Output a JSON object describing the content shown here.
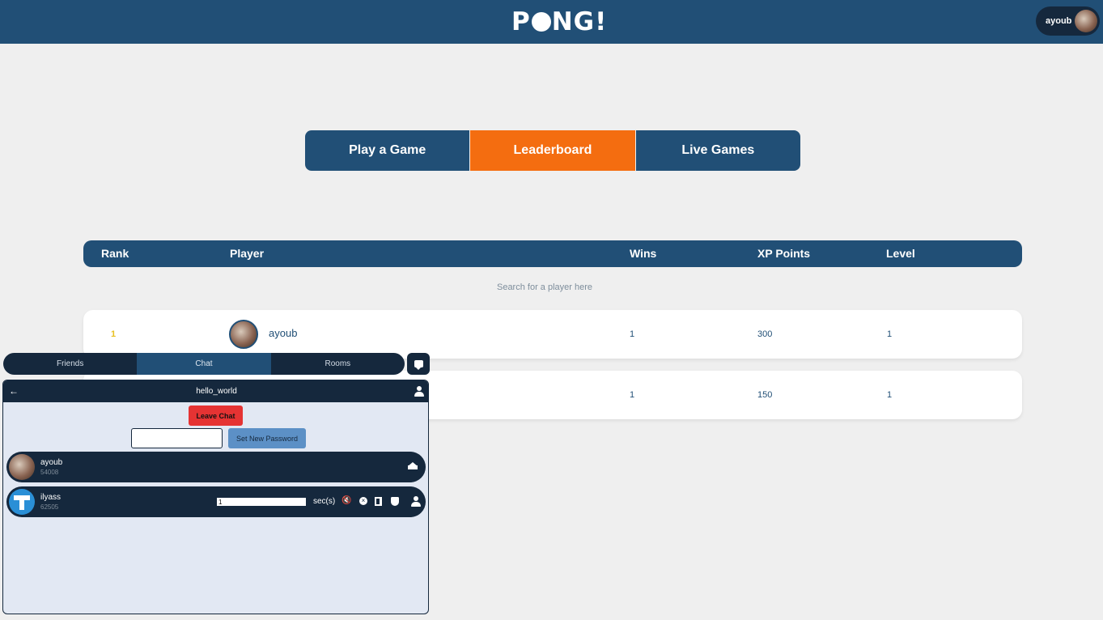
{
  "header": {
    "logo_text_left": "P",
    "logo_text_right": "NG!",
    "username": "ayoub"
  },
  "nav": {
    "tabs": [
      {
        "label": "Play a Game",
        "active": false
      },
      {
        "label": "Leaderboard",
        "active": true
      },
      {
        "label": "Live Games",
        "active": false
      }
    ]
  },
  "leaderboard": {
    "columns": [
      "Rank",
      "Player",
      "Wins",
      "XP Points",
      "Level"
    ],
    "search_placeholder": "Search for a player here",
    "rows": [
      {
        "rank": "1",
        "player": "ayoub",
        "wins": "1",
        "xp": "300",
        "level": "1"
      },
      {
        "rank": "",
        "player": "",
        "wins": "1",
        "xp": "150",
        "level": "1"
      }
    ]
  },
  "chat": {
    "tabs": [
      {
        "label": "Friends",
        "active": false
      },
      {
        "label": "Chat",
        "active": true
      },
      {
        "label": "Rooms",
        "active": false
      }
    ],
    "room_name": "hello_world",
    "leave_label": "Leave Chat",
    "set_password_label": "Set New Password",
    "password_value": "",
    "mute_unit": "sec(s)",
    "members": [
      {
        "name": "ayoub",
        "id": "54008",
        "role": "owner"
      },
      {
        "name": "ilyass",
        "id": "62505",
        "mute_value": "1"
      }
    ]
  },
  "colors": {
    "header_bg": "#214f76",
    "accent": "#f46d10",
    "dark": "#15283d",
    "danger": "#e53333",
    "chat_bg": "#e2e8f3"
  }
}
